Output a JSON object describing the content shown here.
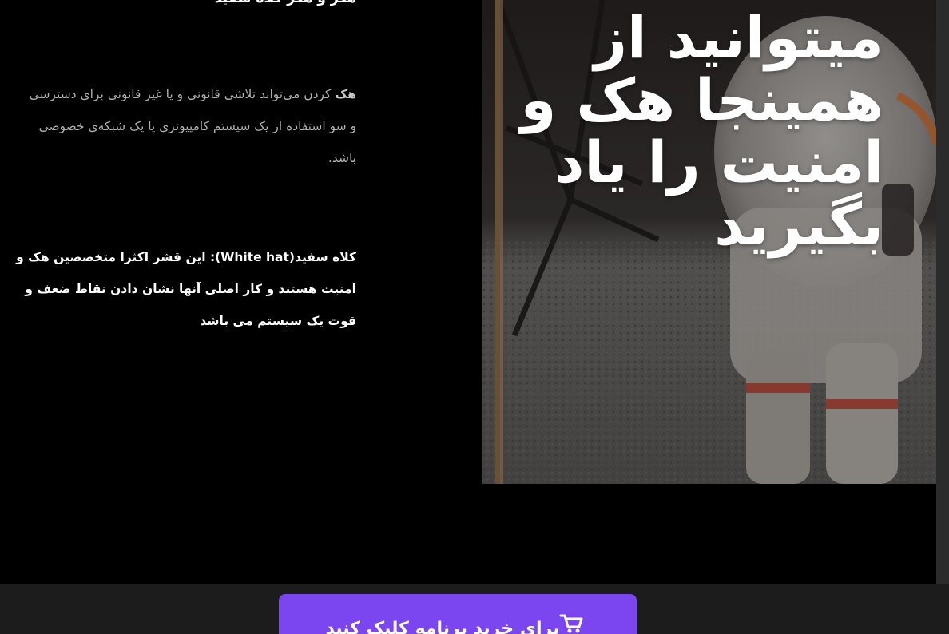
{
  "article": {
    "top_heading": "هکر و هکر کلاه سفید",
    "para1_bold": "هک",
    "para1_text": " کردن می‌تواند تلاشی قانونی و یا غیر قانونی برای دسترسی و سو استفاده از یک سیستم کامپیوتری یا یک شبکه‌ی خصوصی باشد.",
    "para2_text": "کلاه سفید(White hat): این قشر اکثرا متخصصین هک و امنیت هستند و کار اصلی آنها نشان دادن نقاط ضعف و قوت یک سیستم می باشد"
  },
  "hero": {
    "title": "میتوانید از همینجا هک و امنیت را یاد بگیرید",
    "image_icon": "astronaut-moon-photo"
  },
  "cta": {
    "label": "برای خرید برنامه کلیک کنید",
    "icon": "cart-icon",
    "color": "#7b45f0"
  }
}
